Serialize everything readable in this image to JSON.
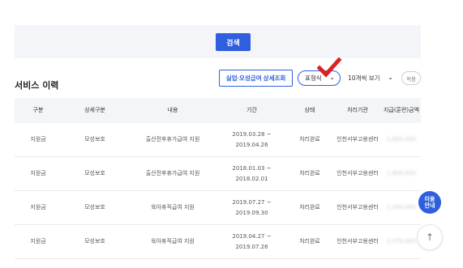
{
  "search": {
    "button_label": "검색"
  },
  "section": {
    "title": "서비스 이력"
  },
  "controls": {
    "detail_button": "실업·모성급여 상세조회",
    "view_select": "표형식",
    "count_select": "10개씩 보기",
    "apply_button": "적용"
  },
  "annotation": {
    "checkmark_color": "#e02020",
    "icon": "checkmark-icon"
  },
  "table": {
    "headers": [
      "구분",
      "상세구분",
      "내용",
      "기간",
      "상태",
      "처리기관",
      "지급(훈련)금액"
    ],
    "rows": [
      {
        "type": "지원금",
        "subtype": "모성보호",
        "content": "출산전후휴가급여 지원",
        "period_start": "2019.03.28 ~",
        "period_end": "2019.04.26",
        "status": "처리완료",
        "agency": "인천서부고용센터",
        "amount": "1,800,000"
      },
      {
        "type": "지원금",
        "subtype": "모성보호",
        "content": "출산전후휴가급여 지원",
        "period_start": "2018.01.03 ~",
        "period_end": "2018.02.01",
        "status": "처리완료",
        "agency": "인천서부고용센터",
        "amount": "1,800,000"
      },
      {
        "type": "지원금",
        "subtype": "모성보호",
        "content": "육아휴직급여 지원",
        "period_start": "2019.07.27 ~",
        "period_end": "2019.09.30",
        "status": "처리완료",
        "agency": "인천서부고용센터",
        "amount": "1,500,000"
      },
      {
        "type": "지원금",
        "subtype": "모성보호",
        "content": "육아휴직급여 지원",
        "period_start": "2019.04.27 ~",
        "period_end": "2019.07.26",
        "status": "처리완료",
        "agency": "인천서부고용센터",
        "amount": "2,375,000"
      }
    ]
  },
  "floating": {
    "guide_line1": "이용",
    "guide_line2": "안내",
    "top_icon": "↑"
  },
  "colors": {
    "accent": "#2f5fde",
    "panel_bg": "#f4f5f8"
  }
}
